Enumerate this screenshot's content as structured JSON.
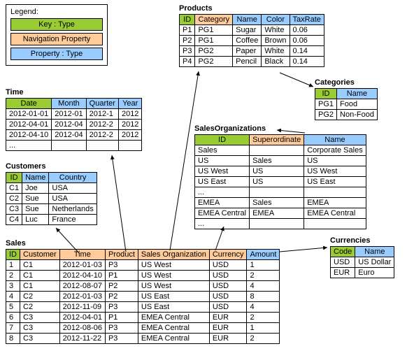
{
  "legend": {
    "title": "Legend:",
    "key": "Key : Type",
    "nav": "Navigation Property",
    "prop": "Property : Type"
  },
  "time": {
    "title": "Time",
    "cols": [
      "Date",
      "Month",
      "Quarter",
      "Year"
    ],
    "colTypes": [
      "key",
      "prop",
      "prop",
      "prop"
    ],
    "rows": [
      [
        "2012-01-01",
        "2012-01",
        "2012-1",
        "2012"
      ],
      [
        "2012-04-01",
        "2012-04",
        "2012-2",
        "2012"
      ],
      [
        "2012-04-10",
        "2012-04",
        "2012-2",
        "2012"
      ],
      [
        "...",
        "",
        "",
        ""
      ]
    ]
  },
  "customers": {
    "title": "Customers",
    "cols": [
      "ID",
      "Name",
      "Country"
    ],
    "colTypes": [
      "key",
      "prop",
      "prop"
    ],
    "rows": [
      [
        "C1",
        "Joe",
        "USA"
      ],
      [
        "C2",
        "Sue",
        "USA"
      ],
      [
        "C3",
        "Sue",
        "Netherlands"
      ],
      [
        "C4",
        "Luc",
        "France"
      ]
    ]
  },
  "products": {
    "title": "Products",
    "cols": [
      "ID",
      "Category",
      "Name",
      "Color",
      "TaxRate"
    ],
    "colTypes": [
      "key",
      "nav",
      "prop",
      "prop",
      "prop"
    ],
    "rows": [
      [
        "P1",
        "PG1",
        "Sugar",
        "White",
        "0.06"
      ],
      [
        "P2",
        "PG1",
        "Coffee",
        "Brown",
        "0.06"
      ],
      [
        "P3",
        "PG2",
        "Paper",
        "White",
        "0.14"
      ],
      [
        "P4",
        "PG2",
        "Pencil",
        "Black",
        "0.14"
      ]
    ]
  },
  "categories": {
    "title": "Categories",
    "cols": [
      "ID",
      "Name"
    ],
    "colTypes": [
      "key",
      "prop"
    ],
    "rows": [
      [
        "PG1",
        "Food"
      ],
      [
        "PG2",
        "Non-Food"
      ]
    ]
  },
  "salesOrg": {
    "title": "SalesOrganizations",
    "cols": [
      "ID",
      "Superordinate",
      "Name"
    ],
    "colTypes": [
      "key",
      "nav",
      "prop"
    ],
    "rows": [
      [
        "Sales",
        "",
        "Corporate Sales"
      ],
      [
        "US",
        "Sales",
        "US"
      ],
      [
        "US West",
        "US",
        "US West"
      ],
      [
        "US East",
        "US",
        "US East"
      ],
      [
        "...",
        "",
        ""
      ],
      [
        "EMEA",
        "Sales",
        "EMEA"
      ],
      [
        "EMEA Central",
        "EMEA",
        "EMEA Central"
      ],
      [
        "...",
        "",
        ""
      ]
    ]
  },
  "currencies": {
    "title": "Currencies",
    "cols": [
      "Code",
      "Name"
    ],
    "colTypes": [
      "key",
      "prop"
    ],
    "rows": [
      [
        "USD",
        "US Dollar"
      ],
      [
        "EUR",
        "Euro"
      ]
    ]
  },
  "sales": {
    "title": "Sales",
    "cols": [
      "ID",
      "Customer",
      "Time",
      "Product",
      "Sales Organization",
      "Currency",
      "Amount"
    ],
    "colTypes": [
      "key",
      "nav",
      "nav",
      "nav",
      "nav",
      "nav",
      "prop"
    ],
    "rows": [
      [
        "1",
        "C1",
        "2012-01-03",
        "P3",
        "US West",
        "USD",
        "1"
      ],
      [
        "2",
        "C1",
        "2012-04-10",
        "P1",
        "US West",
        "USD",
        "2"
      ],
      [
        "3",
        "C1",
        "2012-08-07",
        "P2",
        "US West",
        "USD",
        "4"
      ],
      [
        "4",
        "C2",
        "2012-01-03",
        "P2",
        "US East",
        "USD",
        "8"
      ],
      [
        "5",
        "C2",
        "2012-11-09",
        "P3",
        "US East",
        "USD",
        "4"
      ],
      [
        "6",
        "C3",
        "2012-04-01",
        "P1",
        "EMEA Central",
        "EUR",
        "2"
      ],
      [
        "7",
        "C3",
        "2012-08-06",
        "P3",
        "EMEA Central",
        "EUR",
        "1"
      ],
      [
        "8",
        "C3",
        "2012-11-22",
        "P3",
        "EMEA Central",
        "EUR",
        "2"
      ]
    ]
  }
}
